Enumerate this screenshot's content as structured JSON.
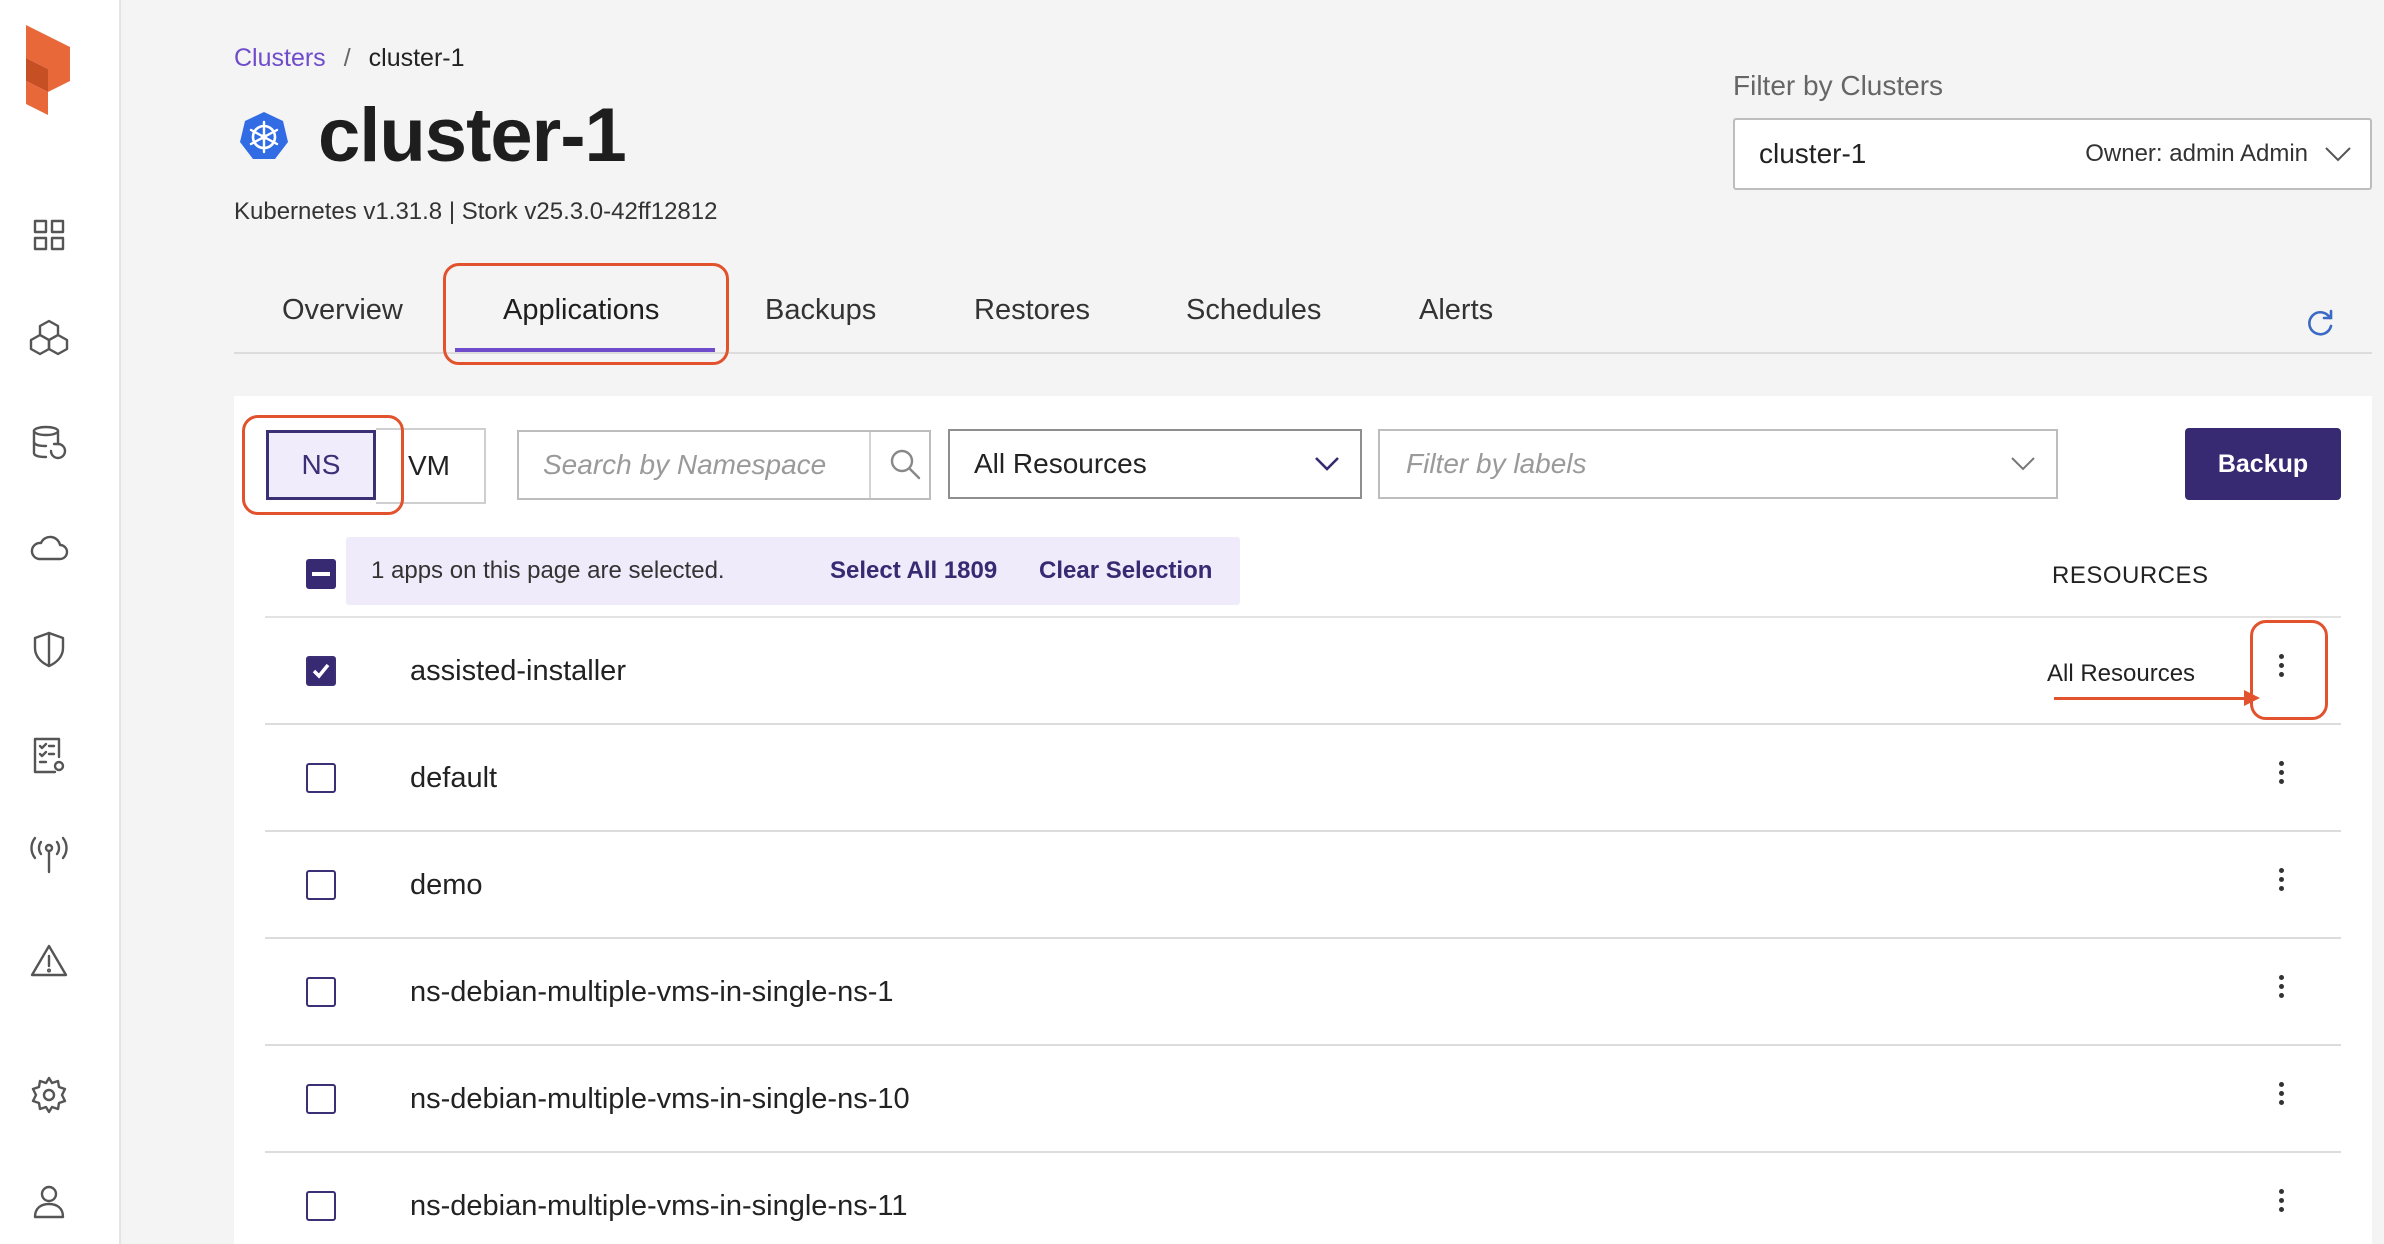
{
  "sidebar": {
    "items": [
      {
        "icon": "dashboard-grid-icon"
      },
      {
        "icon": "applications-cubes-icon"
      },
      {
        "icon": "database-restore-icon"
      },
      {
        "icon": "cloud-icon"
      },
      {
        "icon": "shield-icon"
      },
      {
        "icon": "policy-checklist-icon"
      },
      {
        "icon": "broadcast-antenna-icon"
      },
      {
        "icon": "alert-triangle-icon"
      },
      {
        "icon": "settings-gear-icon"
      },
      {
        "icon": "user-profile-icon"
      }
    ]
  },
  "breadcrumb": {
    "root": "Clusters",
    "separator": "/",
    "current": "cluster-1"
  },
  "header": {
    "title": "cluster-1",
    "subtitle": "Kubernetes v1.31.8 | Stork v25.3.0-42ff12812"
  },
  "cluster_filter": {
    "label": "Filter by Clusters",
    "selected": "cluster-1",
    "owner": "Owner: admin Admin"
  },
  "tabs": [
    {
      "label": "Overview",
      "active": false
    },
    {
      "label": "Applications",
      "active": true
    },
    {
      "label": "Backups",
      "active": false
    },
    {
      "label": "Restores",
      "active": false
    },
    {
      "label": "Schedules",
      "active": false
    },
    {
      "label": "Alerts",
      "active": false
    }
  ],
  "toolbar": {
    "toggle_ns": "NS",
    "toggle_vm": "VM",
    "search_placeholder": "Search by Namespace",
    "resources_selected": "All Resources",
    "labels_placeholder": "Filter by labels",
    "backup_label": "Backup"
  },
  "selection": {
    "message": "1 apps on this page are selected.",
    "select_all": "Select All 1809",
    "clear": "Clear Selection"
  },
  "table": {
    "resources_header": "RESOURCES",
    "rows": [
      {
        "name": "assisted-installer",
        "resources": "All Resources",
        "checked": true
      },
      {
        "name": "default",
        "resources": "",
        "checked": false
      },
      {
        "name": "demo",
        "resources": "",
        "checked": false
      },
      {
        "name": "ns-debian-multiple-vms-in-single-ns-1",
        "resources": "",
        "checked": false
      },
      {
        "name": "ns-debian-multiple-vms-in-single-ns-10",
        "resources": "",
        "checked": false
      },
      {
        "name": "ns-debian-multiple-vms-in-single-ns-11",
        "resources": "",
        "checked": false
      }
    ]
  },
  "colors": {
    "accent": "#6f4ccc",
    "primary_dark": "#372a72",
    "annotation": "#e2522d",
    "logo": "#e8683a"
  }
}
